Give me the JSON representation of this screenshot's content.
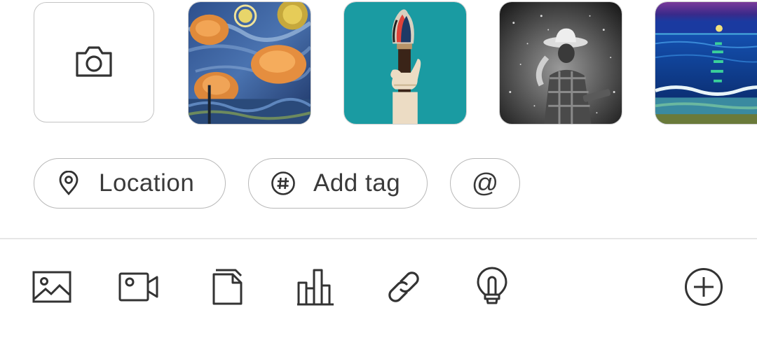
{
  "composer": {
    "camera_tile": {
      "icon": "camera-icon"
    },
    "thumbnails": [
      {
        "id": "cats-starry-night",
        "icon": "image"
      },
      {
        "id": "paintbrush-hand",
        "icon": "image"
      },
      {
        "id": "cowboy-bw",
        "icon": "image"
      },
      {
        "id": "night-seascape",
        "icon": "image"
      }
    ],
    "chips": {
      "location": {
        "label": "Location",
        "icon": "location-pin-icon"
      },
      "tag": {
        "label": "Add tag",
        "icon": "hashtag-icon"
      },
      "mention": {
        "glyph": "@"
      }
    },
    "toolbar": [
      {
        "name": "image",
        "icon": "image-icon"
      },
      {
        "name": "video",
        "icon": "video-camera-icon"
      },
      {
        "name": "document",
        "icon": "document-icon"
      },
      {
        "name": "poll",
        "icon": "bar-chart-icon"
      },
      {
        "name": "link",
        "icon": "link-icon"
      },
      {
        "name": "idea",
        "icon": "lightbulb-icon"
      },
      {
        "name": "more",
        "icon": "plus-circle-icon"
      }
    ]
  },
  "colors": {
    "icon": "#333333",
    "border": "#b8b8b8",
    "divider": "#e6e6e6"
  }
}
